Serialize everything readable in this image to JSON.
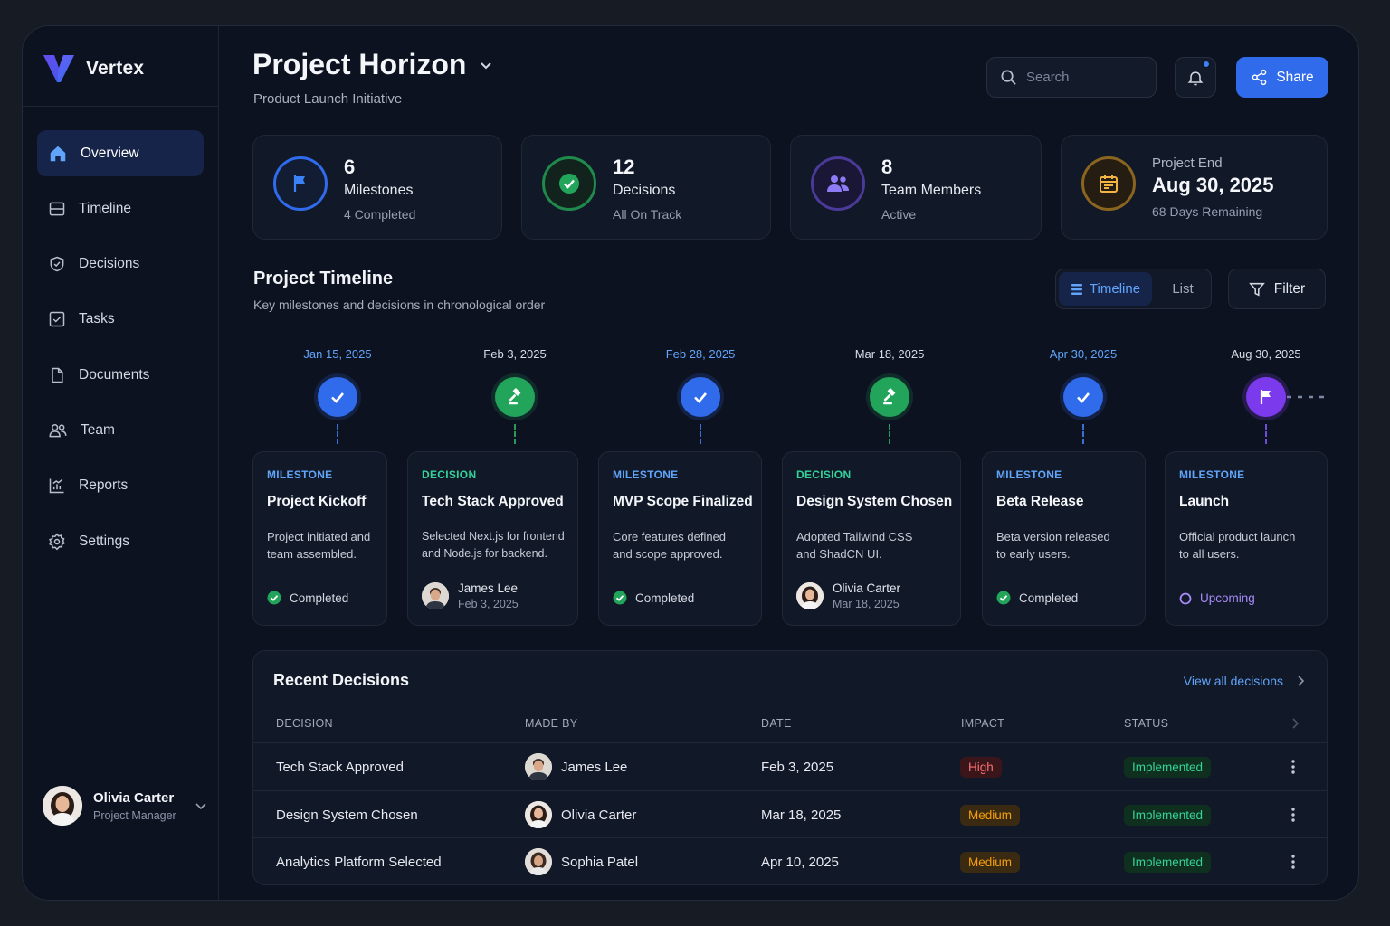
{
  "brand": {
    "name": "Vertex"
  },
  "sidebar": {
    "items": [
      {
        "label": "Overview",
        "icon": "home-icon",
        "active": true
      },
      {
        "label": "Timeline",
        "icon": "timeline-icon"
      },
      {
        "label": "Decisions",
        "icon": "shield-check-icon"
      },
      {
        "label": "Tasks",
        "icon": "checkbox-icon"
      },
      {
        "label": "Documents",
        "icon": "document-icon"
      },
      {
        "label": "Team",
        "icon": "team-icon"
      },
      {
        "label": "Reports",
        "icon": "chart-icon"
      },
      {
        "label": "Settings",
        "icon": "gear-icon"
      }
    ],
    "user": {
      "name": "Olivia Carter",
      "role": "Project Manager"
    }
  },
  "header": {
    "title": "Project Horizon",
    "subtitle": "Product Launch Initiative",
    "search_placeholder": "Search",
    "share_label": "Share"
  },
  "stats": [
    {
      "number": "6",
      "label": "Milestones",
      "sub": "4 Completed",
      "color": "#2f6bea"
    },
    {
      "number": "12",
      "label": "Decisions",
      "sub": "All On Track",
      "color": "#22a55b"
    },
    {
      "number": "8",
      "label": "Team Members",
      "sub": "Active",
      "color": "#6d4bd6"
    },
    {
      "small": "Project End",
      "date": "Aug 30, 2025",
      "sub": "68 Days Remaining",
      "color": "#b7862a"
    }
  ],
  "timeline": {
    "title": "Project Timeline",
    "subtitle": "Key milestones and decisions in chronological order",
    "view_timeline": "Timeline",
    "view_list": "List",
    "filter_label": "Filter",
    "events": [
      {
        "date": "Jan 15, 2025",
        "type": "MILESTONE",
        "title": "Project Kickoff",
        "desc1": "Project initiated and",
        "desc2": "team assembled.",
        "status": "Completed"
      },
      {
        "date": "Feb 3, 2025",
        "type": "DECISION",
        "title": "Tech Stack Approved",
        "desc1": "Selected Next.js for frontend",
        "desc2": "and Node.js for backend.",
        "person": "James Lee",
        "person_date": "Feb 3, 2025"
      },
      {
        "date": "Feb 28, 2025",
        "type": "MILESTONE",
        "title": "MVP Scope Finalized",
        "desc1": "Core features defined",
        "desc2": "and scope approved.",
        "status": "Completed"
      },
      {
        "date": "Mar 18, 2025",
        "type": "DECISION",
        "title": "Design System Chosen",
        "desc1": "Adopted Tailwind CSS",
        "desc2": "and ShadCN UI.",
        "person": "Olivia Carter",
        "person_date": "Mar 18, 2025"
      },
      {
        "date": "Apr 30, 2025",
        "type": "MILESTONE",
        "title": "Beta Release",
        "desc1": "Beta version released",
        "desc2": "to early users.",
        "status": "Completed"
      },
      {
        "date": "Aug 30, 2025",
        "type": "MILESTONE",
        "title": "Launch",
        "desc1": "Official product launch",
        "desc2": "to all users.",
        "status": "Upcoming"
      }
    ]
  },
  "decisions": {
    "title": "Recent Decisions",
    "view_all": "View all decisions",
    "columns": [
      "DECISION",
      "MADE BY",
      "DATE",
      "IMPACT",
      "STATUS"
    ],
    "rows": [
      {
        "decision": "Tech Stack Approved",
        "made_by": "James Lee",
        "date": "Feb 3, 2025",
        "impact": "High",
        "status": "Implemented"
      },
      {
        "decision": "Design System Chosen",
        "made_by": "Olivia Carter",
        "date": "Mar 18, 2025",
        "impact": "Medium",
        "status": "Implemented"
      },
      {
        "decision": "Analytics Platform Selected",
        "made_by": "Sophia Patel",
        "date": "Apr 10, 2025",
        "impact": "Medium",
        "status": "Implemented"
      }
    ]
  }
}
